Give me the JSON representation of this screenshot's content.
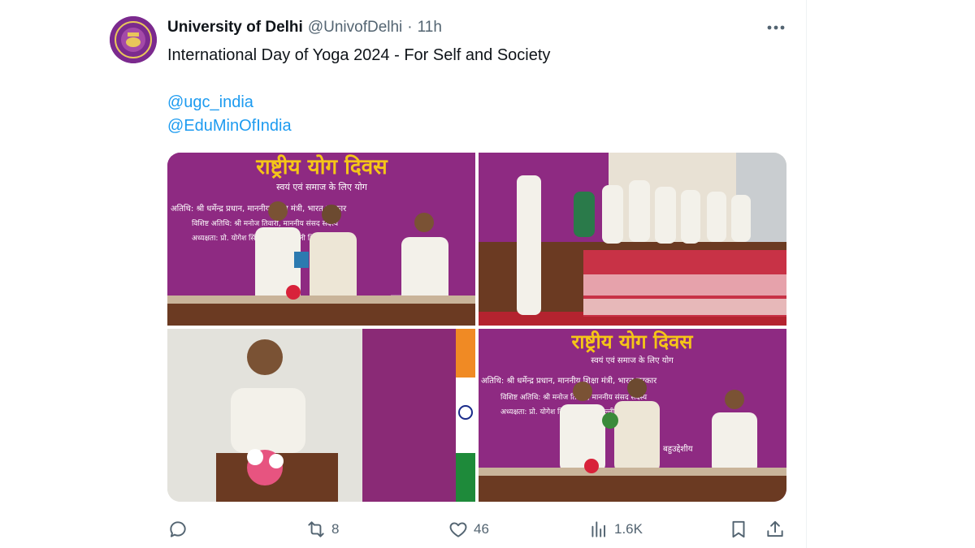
{
  "tweet": {
    "author_name": "University of Delhi",
    "handle": "@UnivofDelhi",
    "separator": "·",
    "time": "11h",
    "more_icon": "more-horizontal-icon",
    "text": "International Day of Yoga 2024 - For Self and Society",
    "mentions": [
      "@ugc_india",
      "@EduMinOfIndia"
    ]
  },
  "media": {
    "banner_title": "राष्ट्रीय योग दिवस",
    "banner_subtitle": "स्वयं एवं समाज के लिए योग",
    "banner_line1": "अतिथि:  श्री धर्मेन्द्र प्रधान,  माननीय शिक्षा मंत्री, भारत सरकार",
    "banner_line2": "विशिष्ट अतिथि:  श्री मनोज तिवारी, माननीय संसद सदस्य",
    "banner_line3": "अध्यक्षता:  प्रो. योगेश सिंह, कुलपति, दिल्ली विश्वविद्यालय",
    "banner_footer": "बहुउद्देशीय"
  },
  "actions": {
    "reply": {
      "icon": "reply-icon",
      "count": ""
    },
    "retweet": {
      "icon": "retweet-icon",
      "count": "8"
    },
    "like": {
      "icon": "heart-icon",
      "count": "46"
    },
    "views": {
      "icon": "views-icon",
      "count": "1.6K"
    },
    "bookmark": {
      "icon": "bookmark-icon"
    },
    "share": {
      "icon": "share-icon"
    }
  },
  "colors": {
    "link": "#1d9bf0",
    "secondary_text": "#536471",
    "banner_purple": "#8e2a82",
    "banner_yellow": "#f5c518"
  }
}
